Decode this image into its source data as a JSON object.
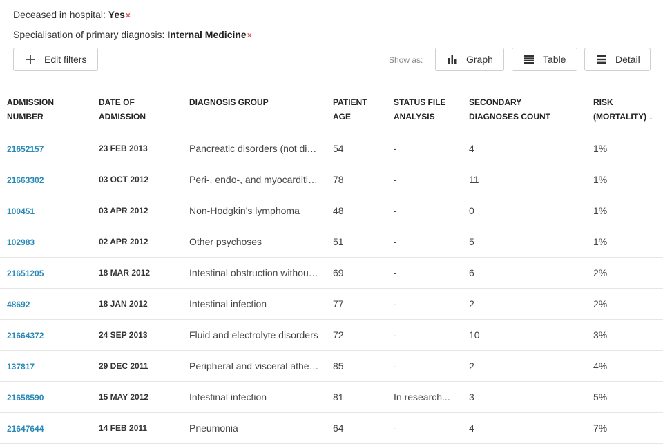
{
  "filters": [
    {
      "label": "Deceased in hospital:",
      "value": "Yes",
      "remove": "×"
    },
    {
      "label": "Specialisation of primary diagnosis:",
      "value": "Internal Medicine",
      "remove": "×"
    }
  ],
  "toolbar": {
    "edit_filters_label": "Edit filters",
    "show_as_label": "Show as:",
    "graph_label": "Graph",
    "table_label": "Table",
    "detail_label": "Detail"
  },
  "icons": {
    "plus": "plus-icon",
    "graph": "bar-chart-icon",
    "table": "table-icon",
    "detail": "list-icon"
  },
  "colors": {
    "link": "#2a8ab7",
    "remove": "#d9534f",
    "border": "#e6e6e6"
  },
  "table": {
    "headers": {
      "admission_number": [
        "Admission",
        "Number"
      ],
      "date_of_admission": [
        "Date of",
        "Admission"
      ],
      "diagnosis_group": [
        "Diagnosis Group",
        ""
      ],
      "patient_age": [
        "Patient",
        "Age"
      ],
      "status_file_analysis": [
        "Status File",
        "Analysis"
      ],
      "secondary_diagnoses_count": [
        "Secondary",
        "Diagnoses Count"
      ],
      "risk": [
        "Risk",
        "(Mortality) ↓"
      ]
    },
    "rows": [
      [
        "21652157",
        "23 FEB 2013",
        "Pancreatic disorders (not diabetes)",
        "54",
        "-",
        "4",
        "1%"
      ],
      [
        "21663302",
        "03 OCT 2012",
        "Peri-, endo-, and myocarditis; cardiomyopathy",
        "78",
        "-",
        "11",
        "1%"
      ],
      [
        "100451",
        "03 APR 2012",
        "Non-Hodgkin's lymphoma",
        "48",
        "-",
        "0",
        "1%"
      ],
      [
        "102983",
        "02 APR 2012",
        "Other psychoses",
        "51",
        "-",
        "5",
        "1%"
      ],
      [
        "21651205",
        "18 MAR 2012",
        "Intestinal obstruction without hernia",
        "69",
        "-",
        "6",
        "2%"
      ],
      [
        "48692",
        "18 JAN 2012",
        "Intestinal infection",
        "77",
        "-",
        "2",
        "2%"
      ],
      [
        "21664372",
        "24 SEP 2013",
        "Fluid and electrolyte disorders",
        "72",
        "-",
        "10",
        "3%"
      ],
      [
        "137817",
        "29 DEC 2011",
        "Peripheral and visceral atherosclerosis",
        "85",
        "-",
        "2",
        "4%"
      ],
      [
        "21658590",
        "15 MAY 2012",
        "Intestinal infection",
        "81",
        "In research...",
        "3",
        "5%"
      ],
      [
        "21647644",
        "14 FEB 2011",
        "Pneumonia",
        "64",
        "-",
        "4",
        "7%"
      ]
    ]
  }
}
